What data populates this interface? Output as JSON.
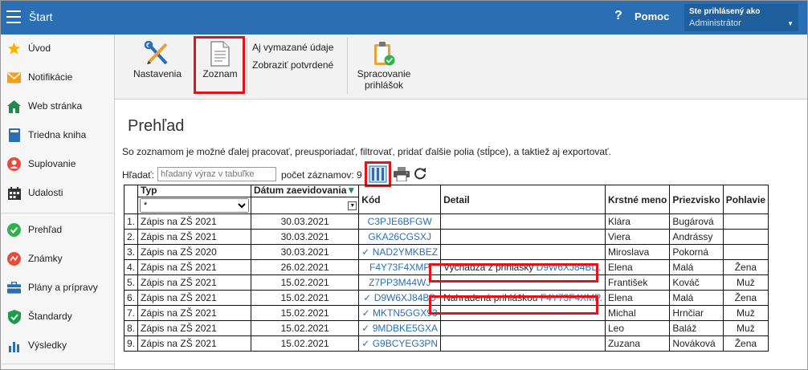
{
  "topbar": {
    "title": "Štart",
    "help_icon": "?",
    "help_label": "Pomoc",
    "user_line1": "Ste prihlásený ako",
    "user_line2": "Administrátor"
  },
  "sidebar": {
    "items": [
      {
        "label": "Úvod",
        "icon": "star-icon"
      },
      {
        "label": "Notifikácie",
        "icon": "envelope-icon"
      },
      {
        "label": "Web stránka",
        "icon": "house-icon"
      },
      {
        "label": "Triedna kniha",
        "icon": "book-icon"
      },
      {
        "label": "Suplovanie",
        "icon": "person-icon"
      },
      {
        "label": "Udalosti",
        "icon": "calendar-icon"
      },
      {
        "label": "Prehľad",
        "icon": "check-circle-icon"
      },
      {
        "label": "Známky",
        "icon": "grades-icon"
      },
      {
        "label": "Plány a prípravy",
        "icon": "briefcase-icon"
      },
      {
        "label": "Štandardy",
        "icon": "shield-check-icon"
      },
      {
        "label": "Výsledky",
        "icon": "bar-chart-icon"
      }
    ]
  },
  "ribbon": {
    "settings_label": "Nastavenia",
    "list_label": "Zoznam",
    "deleted_link": "Aj vymazané údaje",
    "confirmed_link": "Zobraziť potvrdené",
    "processing_line1": "Spracovanie",
    "processing_line2": "prihlášok"
  },
  "main": {
    "title": "Prehľad",
    "description": "So zoznamom je možné ďalej pracovať, preusporiadať, filtrovať, pridať ďalšie polia (stĺpce), a taktiež aj exportovať.",
    "search_label": "Hľadať:",
    "search_placeholder": "hľadaný výraz v tabuľke",
    "count_label": "počet záznamov: 9"
  },
  "table": {
    "headers": [
      "Typ",
      "Dátum zaevidovania",
      "Kód",
      "Detail",
      "Krstné meno",
      "Priezvisko",
      "Pohlavie"
    ],
    "sort_indicator": "▼",
    "type_filter": "*",
    "rows": [
      {
        "n": "1.",
        "typ": "Zápis na ZŠ 2021",
        "datum": "30.03.2021",
        "check": "",
        "kod": "C3PJE6BFGW",
        "detail_text": "",
        "detail_link": "",
        "meno": "Klára",
        "priezvisko": "Bugárová",
        "pohlavie": ""
      },
      {
        "n": "2.",
        "typ": "Zápis na ZŠ 2021",
        "datum": "30.03.2021",
        "check": "",
        "kod": "GKA26CGSXJ",
        "detail_text": "",
        "detail_link": "",
        "meno": "Viera",
        "priezvisko": "Andrássy",
        "pohlavie": ""
      },
      {
        "n": "3.",
        "typ": "Zápis na ZŠ 2020",
        "datum": "30.03.2021",
        "check": "✓",
        "kod": "NAD2YMKBEZ",
        "detail_text": "",
        "detail_link": "",
        "meno": "Miroslava",
        "priezvisko": "Pokorná",
        "pohlavie": ""
      },
      {
        "n": "4.",
        "typ": "Zápis na ZŠ 2021",
        "datum": "26.02.2021",
        "check": "",
        "kod": "F4Y73F4XMP",
        "detail_text": "Vychádza z prihlášky ",
        "detail_link": "D9W6XJ84BD.",
        "meno": "Elena",
        "priezvisko": "Malá",
        "pohlavie": "Žena"
      },
      {
        "n": "5.",
        "typ": "Zápis na ZŠ 2021",
        "datum": "15.02.2021",
        "check": "",
        "kod": "Z7PP3M44WJ",
        "detail_text": "",
        "detail_link": "",
        "meno": "František",
        "priezvisko": "Kováč",
        "pohlavie": "Muž"
      },
      {
        "n": "6.",
        "typ": "Zápis na ZŠ 2021",
        "datum": "15.02.2021",
        "check": "✓",
        "kod": "D9W6XJ84BD",
        "detail_text": "Nahradená prihláškou ",
        "detail_link": "F4Y73F4XMP.",
        "meno": "Elena",
        "priezvisko": "Malá",
        "pohlavie": "Žena"
      },
      {
        "n": "7.",
        "typ": "Zápis na ZŠ 2021",
        "datum": "15.02.2021",
        "check": "✓",
        "kod": "MKTN5GGX93",
        "detail_text": "",
        "detail_link": "",
        "meno": "Michal",
        "priezvisko": "Hrnčiar",
        "pohlavie": "Muž"
      },
      {
        "n": "8.",
        "typ": "Zápis na ZŠ 2021",
        "datum": "15.02.2021",
        "check": "✓",
        "kod": "9MDBKE5GXA",
        "detail_text": "",
        "detail_link": "",
        "meno": "Leo",
        "priezvisko": "Baláž",
        "pohlavie": "Muž"
      },
      {
        "n": "9.",
        "typ": "Zápis na ZŠ 2021",
        "datum": "15.02.2021",
        "check": "✓",
        "kod": "G9BCYEG3PN",
        "detail_text": "",
        "detail_link": "",
        "meno": "Zuzana",
        "priezvisko": "Nováková",
        "pohlavie": "Žena"
      }
    ]
  },
  "colors": {
    "topbar": "#2a6fb3",
    "link": "#2b6fb5",
    "highlight": "#e0141b"
  }
}
